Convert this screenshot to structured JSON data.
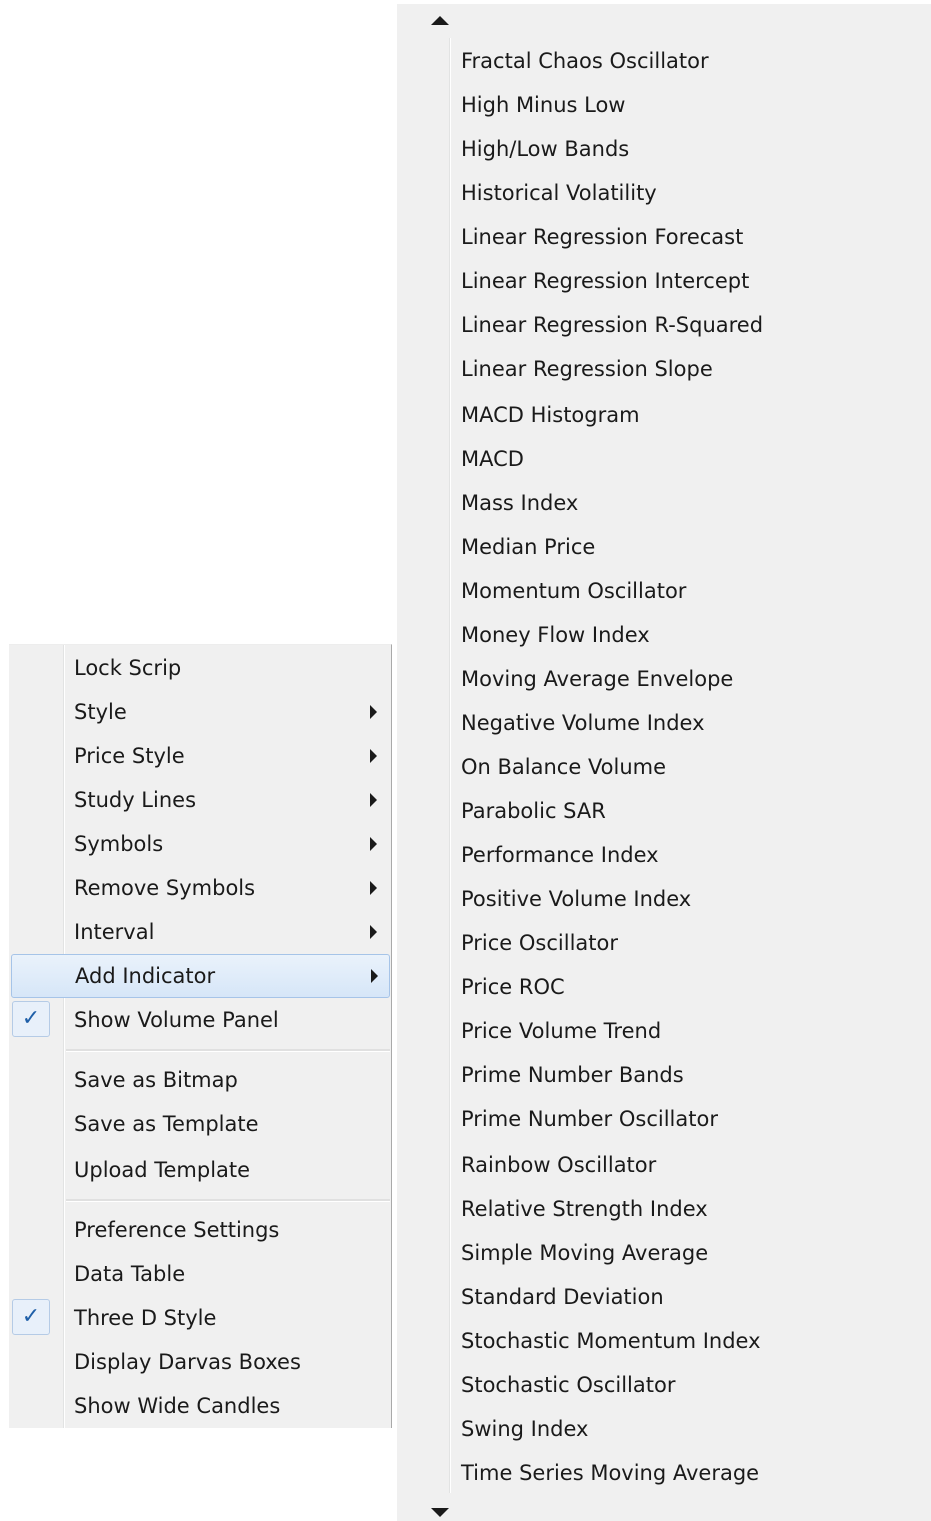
{
  "context_menu": {
    "items": [
      {
        "label": "Lock Scrip",
        "submenu": false,
        "checked": false
      },
      {
        "label": "Style",
        "submenu": true,
        "checked": false
      },
      {
        "label": "Price Style",
        "submenu": true,
        "checked": false
      },
      {
        "label": "Study Lines",
        "submenu": true,
        "checked": false
      },
      {
        "label": "Symbols",
        "submenu": true,
        "checked": false
      },
      {
        "label": "Remove Symbols",
        "submenu": true,
        "checked": false
      },
      {
        "label": "Interval",
        "submenu": true,
        "checked": false
      },
      {
        "label": "Add Indicator",
        "submenu": true,
        "checked": false,
        "highlighted": true
      },
      {
        "label": "Show Volume Panel",
        "submenu": false,
        "checked": true
      },
      {
        "label": "Save as Bitmap",
        "submenu": false,
        "checked": false
      },
      {
        "label": "Save as Template",
        "submenu": false,
        "checked": false
      },
      {
        "label": "Upload Template",
        "submenu": false,
        "checked": false
      },
      {
        "label": "Preference Settings",
        "submenu": false,
        "checked": false
      },
      {
        "label": "Data Table",
        "submenu": false,
        "checked": false
      },
      {
        "label": "Three D Style",
        "submenu": false,
        "checked": true
      },
      {
        "label": "Display Darvas Boxes",
        "submenu": false,
        "checked": false
      },
      {
        "label": "Show Wide Candles",
        "submenu": false,
        "checked": false
      }
    ],
    "check_glyph": "✓",
    "highlight_color": "#d6e6f8"
  },
  "indicator_submenu": {
    "scroll_up_icon": "triangle-up",
    "scroll_down_icon": "triangle-down",
    "items": [
      "Fractal Chaos Oscillator",
      "High Minus Low",
      "High/Low Bands",
      "Historical Volatility",
      "Linear Regression Forecast",
      "Linear Regression Intercept",
      "Linear Regression R-Squared",
      "Linear Regression Slope",
      "MACD Histogram",
      "MACD",
      "Mass Index",
      "Median Price",
      "Momentum Oscillator",
      "Money Flow Index",
      "Moving Average Envelope",
      "Negative Volume Index",
      "On Balance Volume",
      "Parabolic SAR",
      "Performance Index",
      "Positive Volume Index",
      "Price Oscillator",
      "Price ROC",
      "Price Volume Trend",
      "Prime Number Bands",
      "Prime Number Oscillator",
      "Rainbow Oscillator",
      "Relative Strength Index",
      "Simple Moving Average",
      "Standard Deviation",
      "Stochastic Momentum Index",
      "Stochastic Oscillator",
      "Swing Index",
      "Time Series Moving Average"
    ]
  }
}
